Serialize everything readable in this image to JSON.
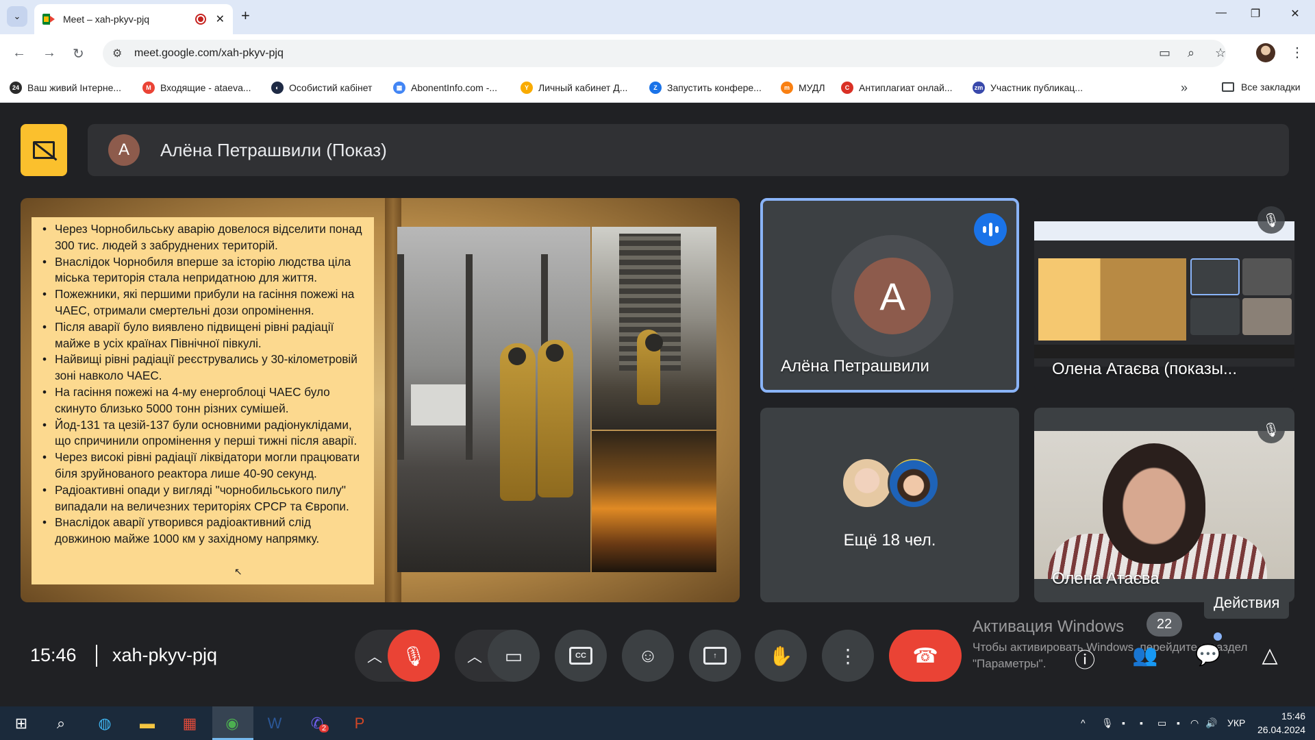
{
  "browser": {
    "tab_title": "Meet – xah-pkyv-pjq",
    "new_tab_label": "+",
    "url": "meet.google.com/xah-pkyv-pjq",
    "bookmarks": [
      {
        "label": "Ваш живий Інтерне...",
        "icon_text": "24",
        "color": "#2b2b2b"
      },
      {
        "label": "Входящие - ataeva...",
        "icon_text": "M",
        "color": "#ea4335"
      },
      {
        "label": "Особистий кабінет",
        "icon_text": "◐",
        "color": "#1e2a44"
      },
      {
        "label": "AbonentInfo.com -...",
        "icon_text": "▦",
        "color": "#4285f4"
      },
      {
        "label": "Личный кабинет Д...",
        "icon_text": "Y",
        "color": "#f9ab00"
      },
      {
        "label": "Запустить конфере...",
        "icon_text": "Z",
        "color": "#1a73e8"
      },
      {
        "label": "МУДЛ",
        "icon_text": "m",
        "color": "#f98012"
      },
      {
        "label": "Антиплагиат онлай...",
        "icon_text": "C",
        "color": "#d93025"
      },
      {
        "label": "Участник публикац...",
        "icon_text": "zm",
        "color": "#3949ab"
      }
    ],
    "all_bookmarks": "Все закладки"
  },
  "meet": {
    "presenter_initial": "А",
    "presenter_title": "Алёна Петрашвили (Показ)",
    "slide_bullets": [
      "Через Чорнобильську аварію довелося відселити понад 300 тис. людей з забруднених територій.",
      "Внаслідок Чорнобиля вперше за історію людства ціла міська територія стала непридатною для життя.",
      "Пожежники, які першими прибули на гасіння пожежі на ЧАЕС, отримали смертельні дози опромінення.",
      "Після аварії було виявлено підвищені рівні радіації майже в усіх країнах Північної півкулі.",
      "Найвищі рівні радіації реєструвались у 30-кілометровій зоні навколо ЧАЕС.",
      "На гасіння пожежі на 4-му енергоблоці ЧАЕС було скинуто близько 5000 тонн різних сумішей.",
      "Йод-131 та цезій-137 були основними радіонуклідами, що спричинили опромінення у перші тижні після аварії.",
      "Через високі рівні радіації ліквідатори могли працювати біля зруйнованого реактора лише 40-90 секунд.",
      "Радіоактивні опади у вигляді \"чорнобильського пилу\" випадали на величезних територіях СРСР та Європи.",
      "Внаслідок аварії утворився радіоактивний слід довжиною майже 1000 км у західному напрямку."
    ],
    "tiles": {
      "speaker_name": "Алёна Петрашвили",
      "speaker_initial": "А",
      "screen_share_name": "Олена Атаєва (показы...",
      "more_label": "Ещё 18 чел.",
      "camera_name": "Олена Атаєва"
    },
    "tooltip": "Действия",
    "time": "15:46",
    "meeting_code": "xah-pkyv-pjq",
    "participants_count": "22",
    "watermark_title": "Активация Windows",
    "watermark_text": "Чтобы активировать Windows, перейдите в раздел \"Параметры\".",
    "colors": {
      "leave": "#ea4335",
      "accent": "#8ab4f8",
      "present_chip": "#fbc02d"
    }
  },
  "taskbar": {
    "lang": "УКР",
    "clock_time": "15:46",
    "clock_date": "26.04.2024",
    "viber_badge": "2"
  }
}
